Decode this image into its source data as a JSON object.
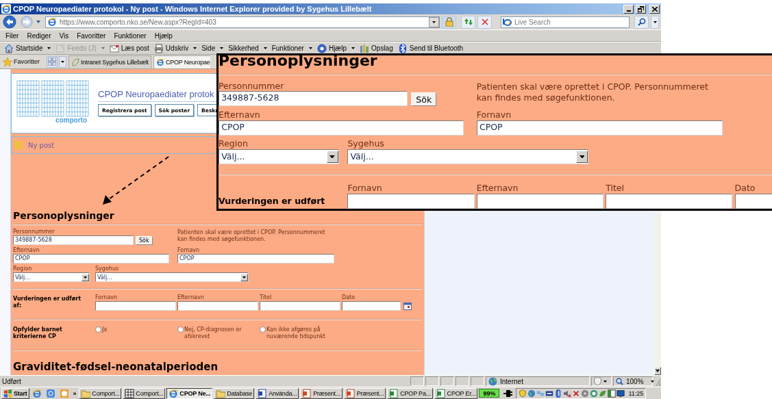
{
  "window": {
    "title": "CPOP Neuropaediater protokol - Ny post - Windows Internet Explorer provided by Sygehus Lillebælt"
  },
  "address_bar": {
    "url": "https://www.comporto.nko.se/New.aspx?RegId=403"
  },
  "search": {
    "placeholder": "Live Search"
  },
  "menu": [
    "Filer",
    "Rediger",
    "Vis",
    "Favoritter",
    "Funktioner",
    "Hjælp"
  ],
  "command_bar": [
    {
      "label": "Startside",
      "dropdown": true,
      "disabled": false
    },
    {
      "label": "Feeds (J)",
      "dropdown": true,
      "disabled": true
    },
    {
      "label": "Læs post",
      "dropdown": false,
      "disabled": false
    },
    {
      "label": "Udskriv",
      "dropdown": true,
      "disabled": false
    },
    {
      "label": "Side",
      "dropdown": true,
      "disabled": false
    },
    {
      "label": "Sikkerhed",
      "dropdown": true,
      "disabled": false
    },
    {
      "label": "Funktioner",
      "dropdown": true,
      "disabled": false
    },
    {
      "label": "Hjælp",
      "dropdown": true,
      "disabled": false
    },
    {
      "label": "Opslag",
      "dropdown": false,
      "disabled": false
    },
    {
      "label": "Send til Bluetooth",
      "dropdown": false,
      "disabled": false
    }
  ],
  "favorites_bar": {
    "label": "Favoritter",
    "links": [
      "Intranet Sygehus Lillebælt"
    ],
    "tabs": [
      {
        "label": "CPOP Neuropae",
        "selected": true
      }
    ]
  },
  "page": {
    "header": {
      "logo_text": "comporto",
      "title": "CPOP Neuropaediater protok",
      "buttons": [
        "Registrera post",
        "Sök poster",
        "Beskr"
      ]
    },
    "breadcrumb": "Ny post",
    "form": {
      "heading": "Personoplysninger",
      "personnummer": {
        "label": "Personnummer",
        "value": "349887-5628"
      },
      "search_button": "Sök",
      "help": "Patienten skal være oprettet i CPOP. Personnummeret kan findes med søgefunktionen.",
      "surname": {
        "label": "Efternavn",
        "value": "CPOP"
      },
      "first_name": {
        "label": "Fornavn",
        "value": "CPOP"
      },
      "region": {
        "label": "Region",
        "value": "Välj..."
      },
      "hospital": {
        "label": "Sygehus",
        "value": "Välj..."
      },
      "assessment": {
        "label": "Vurderingen er udført af:",
        "fields": [
          {
            "label": "Fornavn",
            "kind": "text"
          },
          {
            "label": "Efternavn",
            "kind": "text"
          },
          {
            "label": "Titel",
            "kind": "text"
          },
          {
            "label": "Dato",
            "kind": "date"
          }
        ]
      },
      "criteria": {
        "label": "Opfylder barnet kriterierne CP",
        "options": [
          {
            "label": "Ja",
            "selected": false
          },
          {
            "label": "Nej, CP-diagnosen er afskrevet",
            "selected": false
          },
          {
            "label": "Kan ikke afgøres på nuværende tidspunkt",
            "selected": false
          }
        ]
      },
      "next_heading": "Graviditet-fødsel-neonatalperioden"
    }
  },
  "zoom_callout": {
    "heading": "Personoplysninger",
    "personnummer": {
      "label": "Personnummer",
      "value": "349887-5628"
    },
    "search_button": "Sök",
    "help": "Patienten skal være oprettet i CPOP. Personnummeret kan findes med søgefunktionen.",
    "surname": {
      "label": "Efternavn",
      "value": "CPOP"
    },
    "first_name": {
      "label": "Fornavn",
      "value": "CPOP"
    },
    "region": {
      "label": "Region",
      "value": "Välj..."
    },
    "hospital": {
      "label": "Sygehus",
      "value": "Välj..."
    },
    "assessment": {
      "label": "Vurderingen er udført",
      "fields": [
        {
          "label": "Fornavn",
          "kind": "text"
        },
        {
          "label": "Efternavn",
          "kind": "text"
        },
        {
          "label": "Titel",
          "kind": "text"
        },
        {
          "label": "Dato",
          "kind": "date"
        }
      ]
    }
  },
  "status_bar": {
    "text": "Udført",
    "zone": "Internet",
    "zoom": "100%"
  },
  "taskbar": {
    "start": "Start",
    "more": "»",
    "buttons": [
      {
        "label": "Comport...",
        "kind": "folder",
        "selected": false
      },
      {
        "label": "Comport...",
        "kind": "table",
        "selected": false
      },
      {
        "label": "CPOP Ne...",
        "kind": "browser",
        "selected": true
      },
      {
        "label": "Database",
        "kind": "folder",
        "selected": false
      },
      {
        "label": "Använda...",
        "kind": "document",
        "selected": false
      },
      {
        "label": "Præsent...",
        "kind": "presentation",
        "selected": false
      },
      {
        "label": "Præsent...",
        "kind": "presentation",
        "selected": false
      },
      {
        "label": "CPOP Pa...",
        "kind": "spreadsheet",
        "selected": false
      },
      {
        "label": "CPOP Er...",
        "kind": "spreadsheet",
        "selected": false
      }
    ],
    "battery": "99%",
    "clock": "11:25"
  }
}
